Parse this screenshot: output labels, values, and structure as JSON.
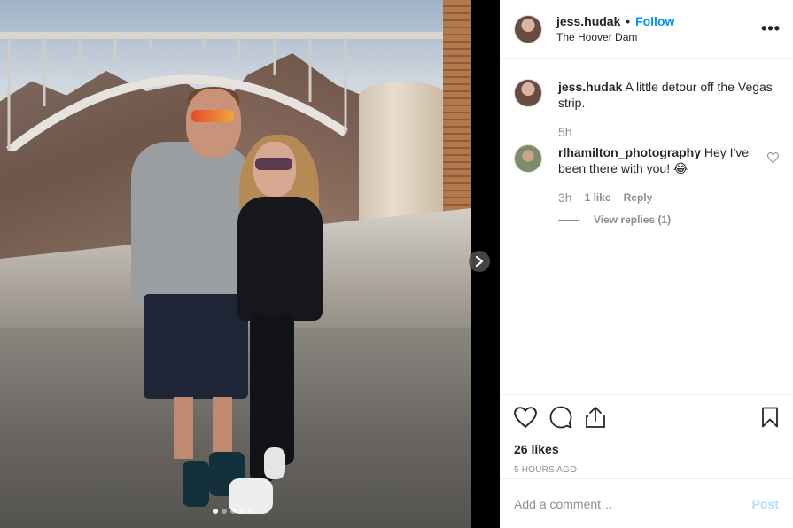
{
  "post": {
    "photo_dots": 5,
    "active_dot": 0
  },
  "header": {
    "username": "jess.hudak",
    "bullet": "•",
    "follow_label": "Follow",
    "location": "The Hoover Dam",
    "more_label": "•••"
  },
  "caption": {
    "username": "jess.hudak",
    "text": "A little detour off the Vegas strip.",
    "time": "5h"
  },
  "comments": [
    {
      "username": "rlhamilton_photography",
      "text": "Hey I've been there with you! 😂",
      "time": "3h",
      "likes": "1 like",
      "reply_label": "Reply",
      "view_replies": "View replies (1)"
    }
  ],
  "actions": {
    "likes": "26 likes",
    "timestamp": "5 HOURS AGO"
  },
  "add_comment": {
    "placeholder": "Add a comment…",
    "post_label": "Post"
  },
  "colors": {
    "accent": "#0095f6",
    "post_disabled": "#b2dffc",
    "muted": "#8e8e8e"
  }
}
